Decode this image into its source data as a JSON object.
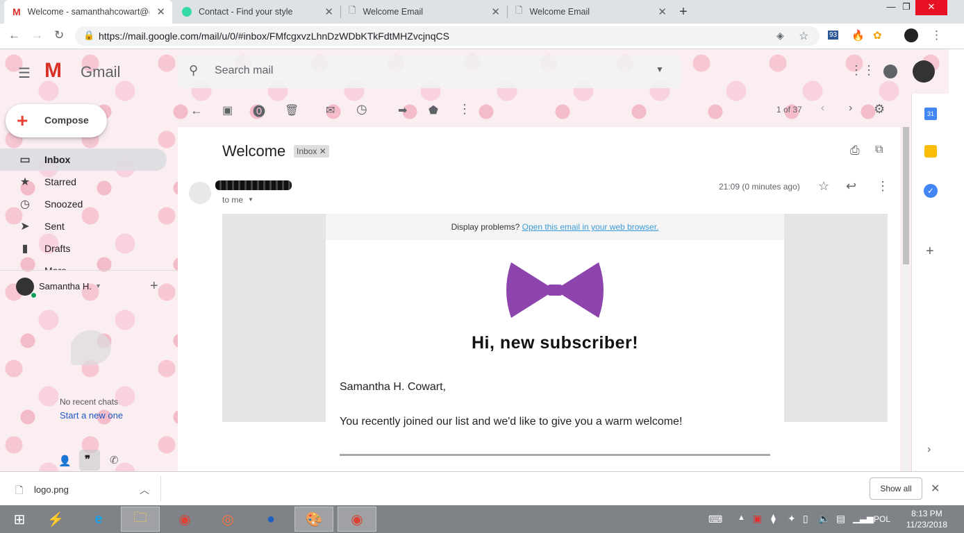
{
  "browser": {
    "tabs": [
      {
        "label": "Welcome - samanthahcowart@g",
        "active": true,
        "icon": "gmail-icon"
      },
      {
        "label": "Contact - Find your style",
        "active": false,
        "icon": "site-icon"
      },
      {
        "label": "Welcome Email",
        "active": false,
        "icon": "page-icon"
      },
      {
        "label": "Welcome Email",
        "active": false,
        "icon": "page-icon"
      }
    ],
    "url": "https://mail.google.com/mail/u/0/#inbox/FMfcgxvzLhnDzWDbKTkFdtMHZvcjnqCS",
    "extension_badge": "93"
  },
  "gmail": {
    "logo_text": "Gmail",
    "search_placeholder": "Search mail",
    "compose_label": "Compose",
    "nav": [
      {
        "label": "Inbox",
        "icon": "inbox-icon",
        "active": true
      },
      {
        "label": "Starred",
        "icon": "star-icon",
        "active": false
      },
      {
        "label": "Snoozed",
        "icon": "clock-icon",
        "active": false
      },
      {
        "label": "Sent",
        "icon": "send-icon",
        "active": false
      },
      {
        "label": "Drafts",
        "icon": "draft-icon",
        "active": false
      },
      {
        "label": "More",
        "icon": "chevron-down-icon",
        "active": false
      }
    ],
    "hangouts": {
      "user": "Samantha H.",
      "no_chats": "No recent chats",
      "start_new": "Start a new one"
    },
    "pagination": "1 of 37",
    "email": {
      "subject": "Welcome",
      "label_chip": "Inbox",
      "to": "to me",
      "time": "21:09 (0 minutes ago)",
      "display_problems": "Display problems?",
      "open_in_browser": "Open this email in your web browser.",
      "greeting": "Hi, new subscriber!",
      "salutation": "Samantha H. Cowart,",
      "body": "You recently joined our list and we'd like to give you a warm welcome!"
    },
    "colors": {
      "bow": "#8e44ad",
      "link": "#3b9bd8",
      "gmail_red": "#d93025"
    }
  },
  "downloads": {
    "file": "logo.png",
    "show_all": "Show all"
  },
  "taskbar": {
    "language": "POL",
    "time": "8:13 PM",
    "date": "11/23/2018"
  }
}
